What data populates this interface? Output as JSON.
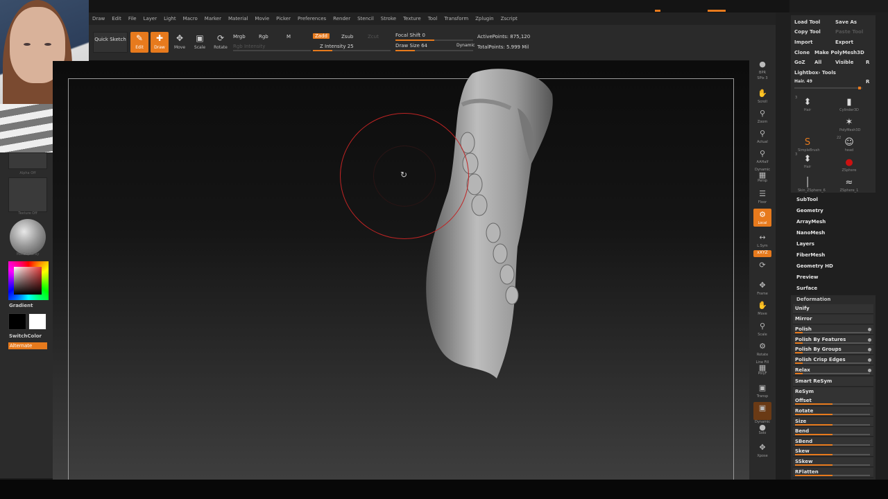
{
  "menu": [
    "Draw",
    "Edit",
    "File",
    "Layer",
    "Light",
    "Macro",
    "Marker",
    "Material",
    "Movie",
    "Picker",
    "Preferences",
    "Render",
    "Stencil",
    "Stroke",
    "Texture",
    "Tool",
    "Transform",
    "Zplugin",
    "Zscript"
  ],
  "toolbar": {
    "quick_sketch": "Quick Sketch",
    "edit": "Edit",
    "draw": "Draw",
    "move": "Move",
    "scale": "Scale",
    "rotate": "Rotate",
    "mrgb": "Mrgb",
    "rgb": "Rgb",
    "m": "M",
    "rgb_intensity": "Rgb Intensity",
    "zadd": "Zadd",
    "zsub": "Zsub",
    "zcut": "Zcut",
    "z_intensity": "Z Intensity 25",
    "focal_shift": "Focal Shift 0",
    "draw_size": "Draw Size 64",
    "dynamic": "Dynamic",
    "active_points": "ActivePoints: 875,120",
    "total_points": "TotalPoints: 5.999 Mil"
  },
  "levels": {
    "rgb_intensity": 0.0,
    "z_intensity": 0.25,
    "focal_shift": 0.5,
    "draw_size": 0.25
  },
  "left": {
    "alpha_caption": "Alpha Off",
    "texture_caption": "Texture Off",
    "matcap_caption": "MatCap Gray",
    "gradient": "Gradient",
    "switch_color": "SwitchColor",
    "alternate": "Alternate"
  },
  "right_shelf": {
    "bpr": "BPR",
    "spix": "SPix 3",
    "scroll": "Scroll",
    "zoom": "Zoom",
    "actual": "Actual",
    "aahalf": "AAHalf",
    "dynamic": "Dynamic",
    "persp": "Persp",
    "floor": "Floor",
    "local": "Local",
    "lsym": "L.Sym",
    "xyz": "xXYZ",
    "frame": "Frame",
    "move": "Move",
    "scale": "Scale",
    "rotate": "Rotate",
    "line_fill": "Line Fill",
    "polyf": "PolyF",
    "transp": "Transp",
    "dynamic2": "Dynamic",
    "solo": "Solo",
    "xpose": "Xpose"
  },
  "tray": {
    "load_tool": "Load Tool",
    "save_as": "Save As",
    "copy_tool": "Copy Tool",
    "paste_tool": "Paste Tool",
    "import": "Import",
    "export": "Export",
    "clone": "Clone",
    "make_polymesh": "Make PolyMesh3D",
    "goz": "GoZ",
    "all": "All",
    "visible": "Visible",
    "r": "R",
    "lightbox_tools": "Lightbox› Tools",
    "hair_label": "Hair. 49",
    "r2": "R",
    "tools": [
      {
        "name": "Hair",
        "count": "3"
      },
      {
        "name": "Cylinder3D",
        "count": ""
      },
      {
        "name": "PolyMesh3D",
        "count": ""
      },
      {
        "name": "SimpleBrush",
        "count": ""
      },
      {
        "name": "head",
        "count": "22"
      },
      {
        "name": "Hair",
        "count": "3"
      },
      {
        "name": "ZSphere",
        "count": ""
      },
      {
        "name": "Skin_ZSphere_6",
        "count": ""
      },
      {
        "name": "ZSphere_1",
        "count": ""
      }
    ],
    "menus": [
      "SubTool",
      "Geometry",
      "ArrayMesh",
      "NanoMesh",
      "Layers",
      "FiberMesh",
      "Geometry HD",
      "Preview",
      "Surface"
    ],
    "deformation": "Deformation",
    "deform_items": [
      {
        "label": "Unify",
        "level": 0
      },
      {
        "label": "Mirror",
        "level": 0
      },
      {
        "label": "Polish",
        "level": 0.1
      },
      {
        "label": "Polish By Features",
        "level": 0.1
      },
      {
        "label": "Polish By Groups",
        "level": 0.1
      },
      {
        "label": "Polish Crisp Edges",
        "level": 0.1
      },
      {
        "label": "Relax",
        "level": 0.1
      },
      {
        "label": "Smart ReSym",
        "level": 0
      },
      {
        "label": "ReSym",
        "level": 0
      },
      {
        "label": "Offset",
        "level": 0.5
      },
      {
        "label": "Rotate",
        "level": 0.5
      },
      {
        "label": "Size",
        "level": 0.5
      },
      {
        "label": "Bend",
        "level": 0.5
      },
      {
        "label": "SBend",
        "level": 0.5
      },
      {
        "label": "Skew",
        "level": 0.5
      },
      {
        "label": "SSkew",
        "level": 0.5
      },
      {
        "label": "RFlatten",
        "level": 0.5
      }
    ]
  },
  "colors": {
    "accent": "#e77a1d",
    "brush_ring": "#c02424"
  }
}
